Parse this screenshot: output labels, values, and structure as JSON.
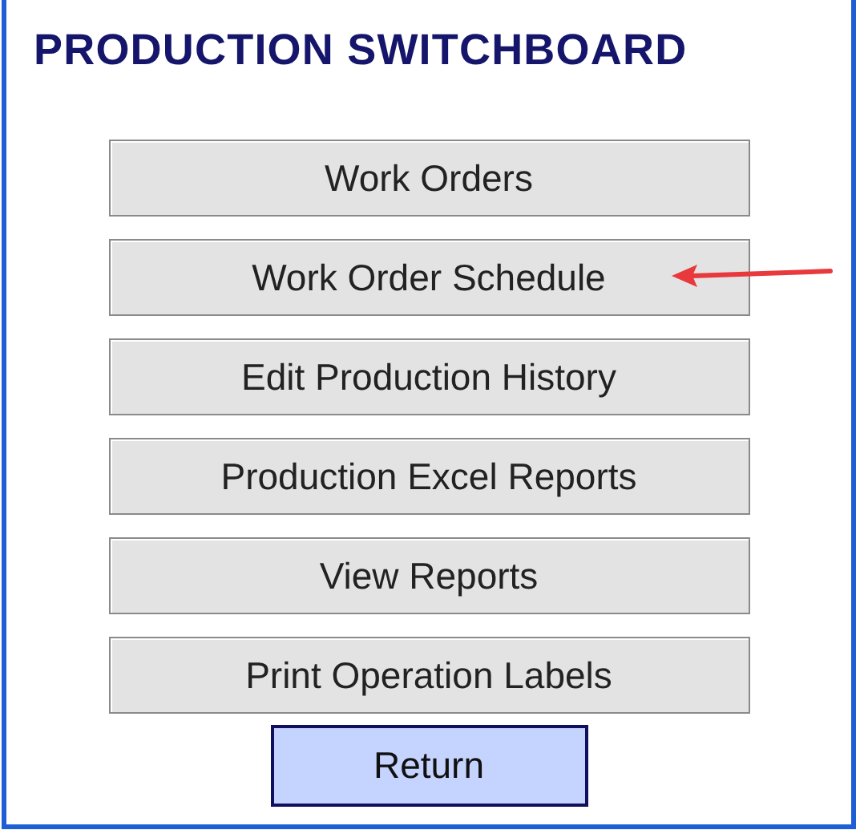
{
  "title": "PRODUCTION SWITCHBOARD",
  "buttons": [
    {
      "label": "Work Orders",
      "kind": "menu",
      "pointed": false
    },
    {
      "label": "Work Order Schedule",
      "kind": "menu",
      "pointed": true
    },
    {
      "label": "Edit Production History",
      "kind": "menu",
      "pointed": false
    },
    {
      "label": "Production Excel Reports",
      "kind": "menu",
      "pointed": false
    },
    {
      "label": "View Reports",
      "kind": "menu",
      "pointed": false
    },
    {
      "label": "Print Operation Labels",
      "kind": "menu",
      "pointed": false
    },
    {
      "label": "Return",
      "kind": "return",
      "pointed": false
    }
  ]
}
